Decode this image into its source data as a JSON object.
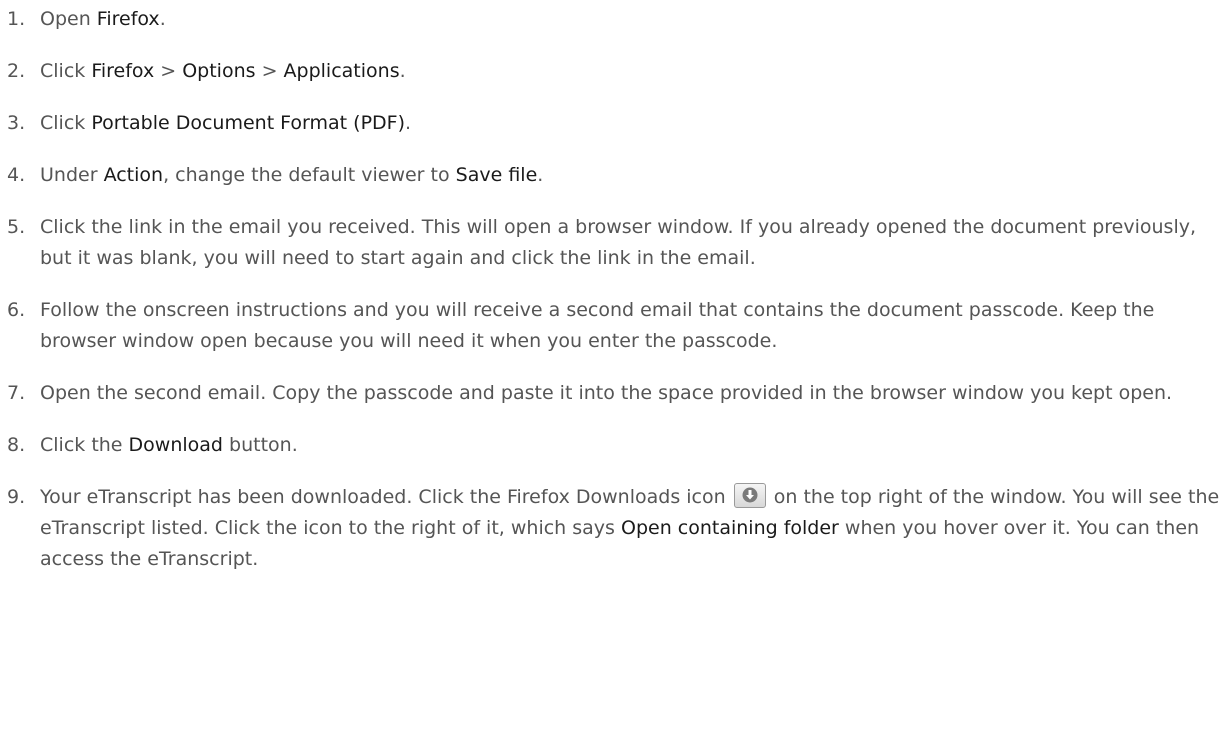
{
  "steps": [
    {
      "num": "1.",
      "segments": [
        {
          "t": "Open "
        },
        {
          "t": "Firefox",
          "hl": true
        },
        {
          "t": "."
        }
      ]
    },
    {
      "num": "2.",
      "segments": [
        {
          "t": "Click "
        },
        {
          "t": "Firefox",
          "hl": true
        },
        {
          "t": " > "
        },
        {
          "t": "Options",
          "hl": true
        },
        {
          "t": " > "
        },
        {
          "t": "Applications",
          "hl": true
        },
        {
          "t": "."
        }
      ]
    },
    {
      "num": "3.",
      "segments": [
        {
          "t": "Click "
        },
        {
          "t": "Portable Document Format (PDF)",
          "hl": true
        },
        {
          "t": "."
        }
      ]
    },
    {
      "num": "4.",
      "segments": [
        {
          "t": "Under "
        },
        {
          "t": "Action",
          "hl": true
        },
        {
          "t": ", change the default viewer to "
        },
        {
          "t": "Save file",
          "hl": true
        },
        {
          "t": "."
        }
      ]
    },
    {
      "num": "5.",
      "segments": [
        {
          "t": "Click the link in the email you received. This will open a browser window. If you already opened the document previously, but it was blank, you will need to start again and click the link in the email."
        }
      ]
    },
    {
      "num": "6.",
      "segments": [
        {
          "t": "Follow the onscreen instructions and you will receive a second email that contains the document passcode. Keep the browser window open because you will need it when you enter the passcode."
        }
      ]
    },
    {
      "num": "7.",
      "segments": [
        {
          "t": "Open the second email. Copy the passcode and paste it into the space provided in the browser window you kept open."
        }
      ]
    },
    {
      "num": "8.",
      "segments": [
        {
          "t": "Click the "
        },
        {
          "t": "Download",
          "hl": true
        },
        {
          "t": " button."
        }
      ]
    },
    {
      "num": "9.",
      "segments": [
        {
          "t": "Your eTranscript has been downloaded. Click the Firefox Downloads icon "
        },
        {
          "icon": "download-icon"
        },
        {
          "t": " on the top right of the window. You will see the eTranscript listed. Click the icon to the right of it, which says "
        },
        {
          "t": "Open containing folder",
          "hl": true
        },
        {
          "t": " when you hover over it. You can then access the eTranscript."
        }
      ]
    }
  ]
}
